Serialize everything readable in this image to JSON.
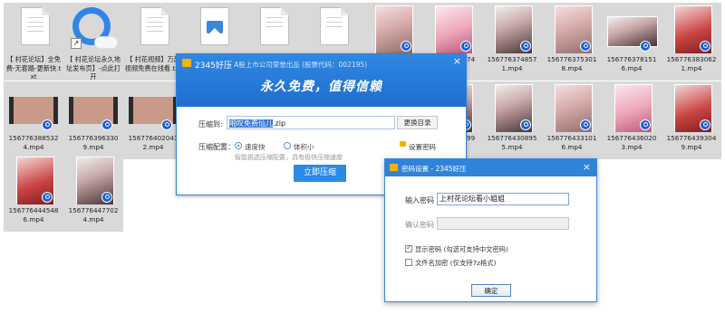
{
  "files": [
    {
      "label": "【 村花论坛】全免费-无套路-更新快.txt",
      "kind": "doc"
    },
    {
      "label": "【 村花论坛永久地址发布页】-点此打开",
      "kind": "ie"
    },
    {
      "label": "【 村花视频】万部视频免费在线看.txt",
      "kind": "doc"
    },
    {
      "label": "",
      "kind": "image"
    },
    {
      "label": "",
      "kind": "doc"
    },
    {
      "label": "",
      "kind": "doc"
    },
    {
      "label": "",
      "kind": "photo"
    },
    {
      "label": "15677637374",
      "kind": "photo"
    },
    {
      "label": "156776374857 1.mp4",
      "kind": "photo"
    },
    {
      "label": "156776375301 8.mp4",
      "kind": "photo"
    },
    {
      "label": "156776378151 6.mp4",
      "kind": "photo"
    },
    {
      "label": "156776383062 1.mp4",
      "kind": "photo"
    },
    {
      "label": "156776388532 4.mp4",
      "kind": "video"
    },
    {
      "label": "156776396330 9.mp4",
      "kind": "video"
    },
    {
      "label": "156776402043 2.mp4",
      "kind": "video"
    },
    {
      "label": "15677642799",
      "kind": "photo"
    },
    {
      "label": "156776430895 5.mp4",
      "kind": "photo"
    },
    {
      "label": "156776433101 6.mp4",
      "kind": "photo"
    },
    {
      "label": "156776436020 3.mp4",
      "kind": "photo"
    },
    {
      "label": "156776439304 9.mp4",
      "kind": "photo"
    },
    {
      "label": "156776444548 6.mp4",
      "kind": "photo"
    },
    {
      "label": "156776447702 4.mp4",
      "kind": "photo"
    }
  ],
  "zip_window": {
    "app_name": "2345好压",
    "subtitle": "- A股上市公司荣誉出品 (股票代码：002195)",
    "close": "×",
    "slogan": "永久免费，值得信赖",
    "path_label": "压缩到:",
    "path_selected": "啪叹免费仙儿",
    "path_rest": ".zip",
    "browse_button": "更换目录",
    "config_label": "压缩配置：",
    "option_fast": "速度快",
    "option_small": "体积小",
    "hint": "智能挑选压缩配置，具有极快压缩速度",
    "set_password": "设置密码",
    "compress_button": "立即压缩"
  },
  "password_dialog": {
    "title": "密码设置 - 2345好压",
    "close": "×",
    "enter_label": "输入密码",
    "enter_value": "上村花论坛看小姐姐",
    "confirm_label": "确认密码",
    "confirm_value": "",
    "show_password": "显示密码 (勾选可支持中文密码)",
    "show_password_checked": true,
    "encrypt_names": "文件名加密 (仅支持7z格式)",
    "encrypt_names_checked": false,
    "ok_button": "确定"
  }
}
